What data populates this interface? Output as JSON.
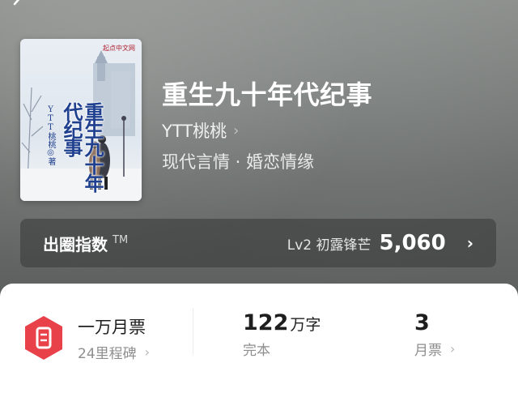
{
  "book": {
    "title": "重生九十年代纪事",
    "author": "YTT桃桃",
    "genre": "现代言情 · 婚恋情缘",
    "cover": {
      "title": "重生九十年代纪事",
      "author": "YTT桃桃◎著",
      "logo": "起点中文网"
    }
  },
  "popularity_index": {
    "label": "出圈指数",
    "trademark": "TM",
    "level": "Lv2 初露锋芒",
    "value": "5,060"
  },
  "stats": {
    "monthly_ticket_badge": {
      "title": "一万月票",
      "subtitle": "24里程碑"
    },
    "words": {
      "value": "122",
      "unit": "万字",
      "label": "完本"
    },
    "monthly_votes": {
      "value": "3",
      "label": "月票"
    }
  },
  "icons": {
    "back": "back-arrow-icon",
    "chevron": "chevron-right-icon",
    "ticket": "ticket-icon"
  },
  "colors": {
    "accent": "#e8414a",
    "panel": "#ffffff"
  }
}
